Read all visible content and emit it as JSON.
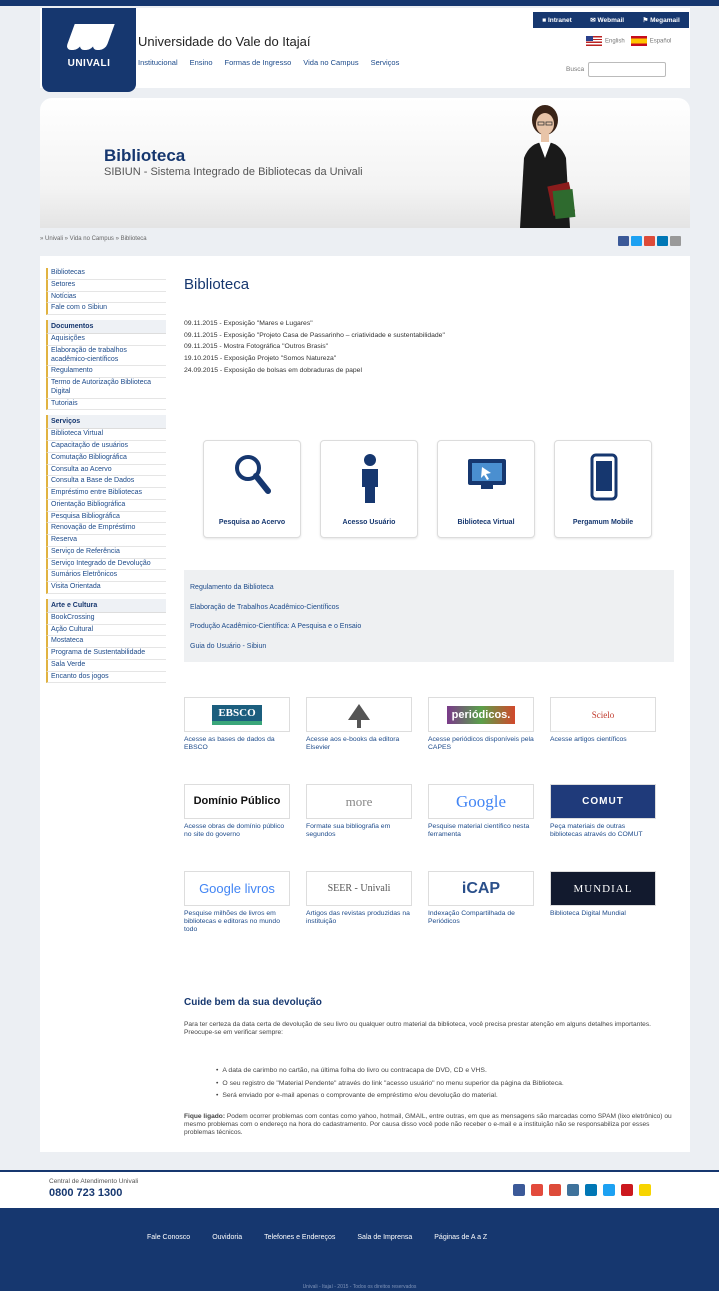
{
  "header": {
    "university_name": "Universidade do Vale do Itajaí",
    "logo_text": "UNIVALI",
    "nav": [
      "Institucional",
      "Ensino",
      "Formas de Ingresso",
      "Vida no Campus",
      "Serviços"
    ],
    "top_links": [
      "Intranet",
      "Webmail",
      "Megamail"
    ],
    "languages": [
      "English",
      "Español"
    ],
    "search_label": "Busca"
  },
  "banner": {
    "title": "Biblioteca",
    "subtitle": "SIBIUN - Sistema Integrado de Bibliotecas da Univali"
  },
  "breadcrumb": "» Univali » Vida no Campus » Biblioteca",
  "sidebar": {
    "group1": [
      "Bibliotecas",
      "Setores",
      "Notícias",
      "Fale com o Sibiun"
    ],
    "group2_title": "Documentos",
    "group2": [
      "Aquisições",
      "Elaboração de trabalhos acadêmico-científicos",
      "Regulamento",
      "Termo de Autorização Biblioteca Digital",
      "Tutoriais"
    ],
    "group3_title": "Serviços",
    "group3": [
      "Biblioteca Virtual",
      "Capacitação de usuários",
      "Comutação Bibliográfica",
      "Consulta ao Acervo",
      "Consulta a Base de Dados",
      "Empréstimo entre Bibliotecas",
      "Orientação Bibliográfica",
      "Pesquisa Bibliográfica",
      "Renovação de Empréstimo",
      "Reserva",
      "Serviço de Referência",
      "Serviço Integrado de Devolução",
      "Sumários Eletrônicos",
      "Visita Orientada"
    ],
    "group4_title": "Arte e Cultura",
    "group4": [
      "BookCrossing",
      "Ação Cultural",
      "Mostateca",
      "Programa de Sustentabilidade",
      "Sala Verde",
      "Encanto dos jogos"
    ]
  },
  "main": {
    "title": "Biblioteca",
    "news": [
      "09.11.2015 - Exposição \"Mares e Lugares\"",
      "09.11.2015 - Exposição \"Projeto Casa de Passarinho – criatividade e sustentabilidade\"",
      "09.11.2015 - Mostra Fotográfica \"Outros Brasis\"",
      "19.10.2015 - Exposição Projeto \"Somos Natureza\"",
      "24.09.2015 - Exposição de bolsas em dobraduras de papel"
    ],
    "tiles": [
      "Pesquisa ao Acervo",
      "Acesso Usuário",
      "Biblioteca Virtual",
      "Pergamum Mobile"
    ],
    "links": [
      "Regulamento da Biblioteca",
      "Elaboração de Trabalhos Acadêmico-Científicos",
      "Produção Acadêmico-Científica: A Pesquisa e o Ensaio",
      "Guia do Usuário - Sibiun"
    ],
    "resources": [
      {
        "logo": "EBSCO",
        "caption": "Acesse as bases de dados da EBSCO"
      },
      {
        "logo": "ELSEVIER",
        "caption": "Acesse aos e-books da editora Elsevier"
      },
      {
        "logo": "periódicos.",
        "caption": "Acesse periódicos disponíveis pela CAPES"
      },
      {
        "logo": "Scielo",
        "caption": "Acesse artigos científicos"
      },
      {
        "logo": "Domínio Público",
        "caption": "Acesse obras de domínio público no site do governo"
      },
      {
        "logo": "more",
        "caption": "Formate sua bibliografia em segundos"
      },
      {
        "logo": "Google",
        "caption": "Pesquise material científico nesta ferramenta"
      },
      {
        "logo": "COMUT",
        "caption": "Peça materiais de outras bibliotecas através do COMUT"
      },
      {
        "logo": "Google livros",
        "caption": "Pesquise milhões de livros em bibliotecas e editoras no mundo todo"
      },
      {
        "logo": "SEER - Univali",
        "caption": "Artigos das revistas produzidas na instituição"
      },
      {
        "logo": "iCAP",
        "caption": "Indexação Compartilhada de Periódicos"
      },
      {
        "logo": "MUNDIAL",
        "caption": "Biblioteca Digital Mundial"
      }
    ],
    "devolution_title": "Cuide bem da sua devolução",
    "devolution_intro": "Para ter certeza da data certa de devolução de seu livro ou qualquer outro material da biblioteca, você precisa prestar atenção em alguns detalhes importantes.",
    "devolution_intro2": "Preocupe-se em verificar sempre:",
    "bullets": [
      "A data de carimbo no cartão, na última folha do livro ou contracapa de DVD, CD e VHS.",
      "O seu registro de \"Material Pendente\" através do link \"acesso usuário\" no menu superior da página da Biblioteca.",
      "Será enviado por e-mail apenas o comprovante de empréstimo e/ou devolução do material."
    ],
    "tip_label": "Fique ligado:",
    "tip_text": "Podem ocorrer problemas com contas como yahoo, hotmail, GMAIL, entre outras, em que as mensagens são marcadas como SPAM (lixo eletrônico) ou mesmo problemas com o endereço na hora do cadastramento. Por causa disso você pode não receber o e-mail e a instituição não se responsabiliza por esses problemas técnicos."
  },
  "footer": {
    "central_label": "Central de Atendimento Univali",
    "phone": "0800 723 1300",
    "nav": [
      "Fale Conosco",
      "Ouvidoria",
      "Telefones e Endereços",
      "Sala de Imprensa",
      "Páginas de A a Z"
    ],
    "copyright": "Univali - Itajaí - 2015 - Todos os direitos reservados"
  },
  "colors": {
    "brand": "#16376f",
    "accent": "#e1b341"
  }
}
